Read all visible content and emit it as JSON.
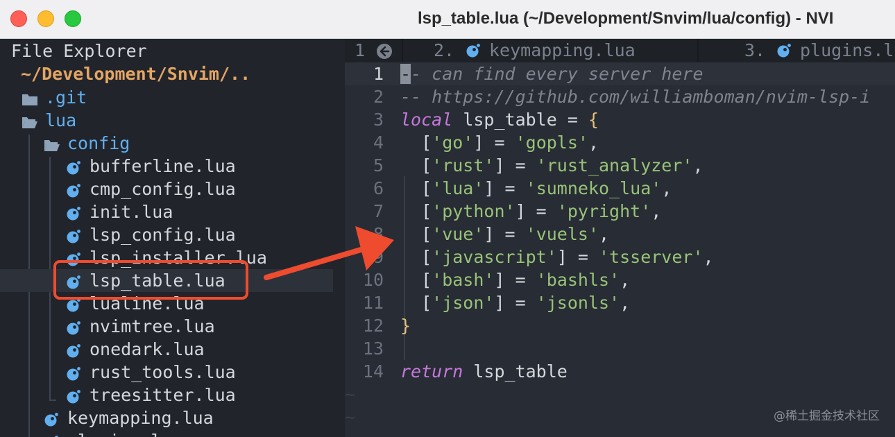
{
  "window": {
    "title": "lsp_table.lua (~/Development/Snvim/lua/config) - NVI",
    "accent_color": "#ee4b2f"
  },
  "explorer": {
    "header": "File Explorer",
    "root": "~/Development/Snvim/..",
    "items": [
      {
        "label": ".git",
        "icon": "folder-icon",
        "type": "dir"
      },
      {
        "label": "lua",
        "icon": "folder-open-icon",
        "type": "dir"
      },
      {
        "label": "config",
        "icon": "folder-open-icon",
        "type": "dir"
      },
      {
        "label": "bufferline.lua",
        "icon": "lua-file-icon",
        "type": "file"
      },
      {
        "label": "cmp_config.lua",
        "icon": "lua-file-icon",
        "type": "file"
      },
      {
        "label": "init.lua",
        "icon": "lua-file-icon",
        "type": "file"
      },
      {
        "label": "lsp_config.lua",
        "icon": "lua-file-icon",
        "type": "file"
      },
      {
        "label": "lsp_installer.lua",
        "icon": "lua-file-icon",
        "type": "file"
      },
      {
        "label": "lsp_table.lua",
        "icon": "lua-file-icon",
        "type": "file",
        "selected": true
      },
      {
        "label": "lualine.lua",
        "icon": "lua-file-icon",
        "type": "file"
      },
      {
        "label": "nvimtree.lua",
        "icon": "lua-file-icon",
        "type": "file"
      },
      {
        "label": "onedark.lua",
        "icon": "lua-file-icon",
        "type": "file"
      },
      {
        "label": "rust_tools.lua",
        "icon": "lua-file-icon",
        "type": "file"
      },
      {
        "label": "treesitter.lua",
        "icon": "lua-file-icon",
        "type": "file"
      },
      {
        "label": "keymapping.lua",
        "icon": "lua-file-icon",
        "type": "file"
      },
      {
        "label": "plugins.lua",
        "icon": "lua-file-icon",
        "type": "file"
      }
    ]
  },
  "tabs": [
    {
      "number": "1",
      "label": "",
      "icon": "back-circle-icon"
    },
    {
      "number": "2.",
      "label": "keymapping.lua",
      "icon": "lua-file-icon"
    },
    {
      "number": "3.",
      "label": "plugins.l",
      "icon": "lua-file-icon"
    }
  ],
  "editor": {
    "lines": [
      {
        "num": "1",
        "parts": [
          [
            "cursor",
            "-"
          ],
          [
            "c-comment",
            "- can find every server here"
          ]
        ]
      },
      {
        "num": "2",
        "parts": [
          [
            "c-comment",
            "-- https://github.com/williamboman/nvim-lsp-i"
          ]
        ]
      },
      {
        "num": "3",
        "parts": [
          [
            "c-kw",
            "local"
          ],
          [
            "",
            " lsp_table = "
          ],
          [
            "c-br",
            "{"
          ]
        ]
      },
      {
        "num": "4",
        "parts": [
          [
            "",
            "  ["
          ],
          [
            "c-str",
            "'go'"
          ],
          [
            "",
            "] = "
          ],
          [
            "c-str",
            "'gopls'"
          ],
          [
            "",
            ","
          ]
        ]
      },
      {
        "num": "5",
        "parts": [
          [
            "",
            "  ["
          ],
          [
            "c-str",
            "'rust'"
          ],
          [
            "",
            "] = "
          ],
          [
            "c-str",
            "'rust_analyzer'"
          ],
          [
            "",
            ","
          ]
        ]
      },
      {
        "num": "6",
        "parts": [
          [
            "",
            "  ["
          ],
          [
            "c-str",
            "'lua'"
          ],
          [
            "",
            "] = "
          ],
          [
            "c-str",
            "'sumneko_lua'"
          ],
          [
            "",
            ","
          ]
        ]
      },
      {
        "num": "7",
        "parts": [
          [
            "",
            "  ["
          ],
          [
            "c-str",
            "'python'"
          ],
          [
            "",
            "] = "
          ],
          [
            "c-str",
            "'pyright'"
          ],
          [
            "",
            ","
          ]
        ]
      },
      {
        "num": "8",
        "parts": [
          [
            "",
            "  ["
          ],
          [
            "c-str",
            "'vue'"
          ],
          [
            "",
            "] = "
          ],
          [
            "c-str",
            "'vuels'"
          ],
          [
            "",
            ","
          ]
        ]
      },
      {
        "num": "9",
        "parts": [
          [
            "",
            "  ["
          ],
          [
            "c-str",
            "'javascript'"
          ],
          [
            "",
            "] = "
          ],
          [
            "c-str",
            "'tsserver'"
          ],
          [
            "",
            ","
          ]
        ]
      },
      {
        "num": "10",
        "parts": [
          [
            "",
            "  ["
          ],
          [
            "c-str",
            "'bash'"
          ],
          [
            "",
            "] = "
          ],
          [
            "c-str",
            "'bashls'"
          ],
          [
            "",
            ","
          ]
        ]
      },
      {
        "num": "11",
        "parts": [
          [
            "",
            "  ["
          ],
          [
            "c-str",
            "'json'"
          ],
          [
            "",
            "] = "
          ],
          [
            "c-str",
            "'jsonls'"
          ],
          [
            "",
            ","
          ]
        ]
      },
      {
        "num": "12",
        "parts": [
          [
            "c-br",
            "}"
          ]
        ]
      },
      {
        "num": "13",
        "parts": []
      },
      {
        "num": "14",
        "parts": [
          [
            "c-kw",
            "return"
          ],
          [
            "",
            " lsp_table"
          ]
        ]
      }
    ],
    "empty_marker": "~"
  },
  "watermark": "@稀土掘金技术社区"
}
